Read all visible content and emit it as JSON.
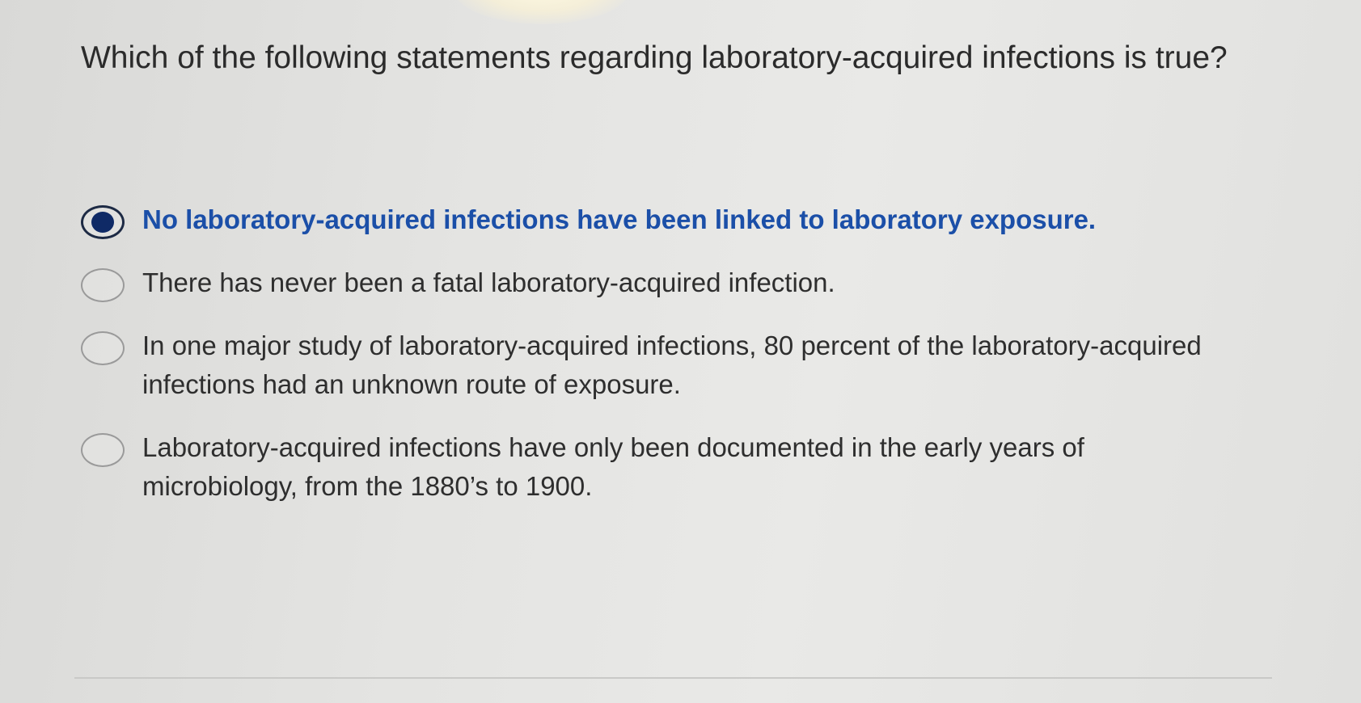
{
  "question": {
    "text": "Which of the following statements regarding laboratory-acquired infections is true?"
  },
  "options": [
    {
      "text": "No laboratory-acquired infections have been linked to laboratory exposure.",
      "selected": true
    },
    {
      "text": "There has never been a fatal laboratory-acquired infection.",
      "selected": false
    },
    {
      "text": "In one major study of laboratory-acquired infections, 80 percent of the laboratory-acquired infections had an unknown route of exposure.",
      "selected": false
    },
    {
      "text": "Laboratory-acquired infections have only been documented in the early years of microbiology, from the 1880’s to 1900.",
      "selected": false
    }
  ],
  "colors": {
    "selected_text": "#1b4fa8",
    "radio_fill": "#0f2a66",
    "text": "#2e2e2e",
    "background": "#e4e4e2"
  }
}
